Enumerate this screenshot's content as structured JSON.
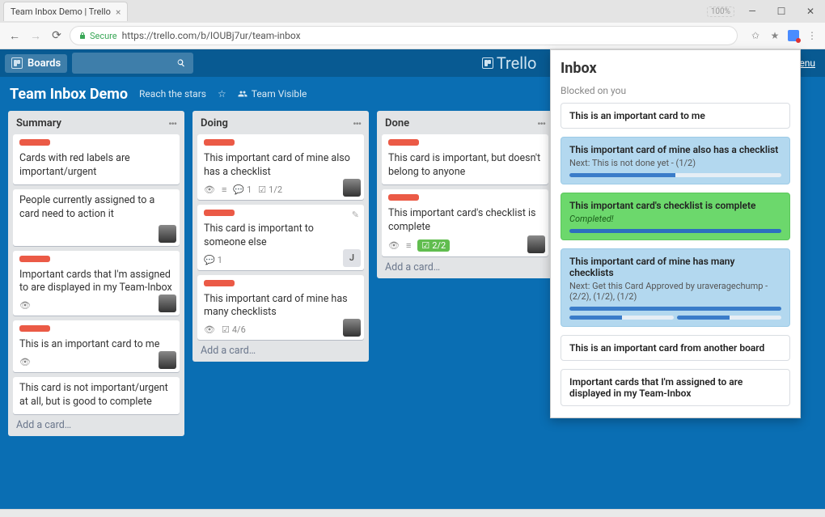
{
  "browser": {
    "tab_title": "Team Inbox Demo | Trello",
    "secure_label": "Secure",
    "url": "https://trello.com/b/IOUBj7ur/team-inbox",
    "win_indicator": "100%"
  },
  "header": {
    "boards_btn": "Boards",
    "logo_text": "Trello",
    "menu_link": "enu"
  },
  "board": {
    "name": "Team Inbox Demo",
    "subtitle": "Reach the stars",
    "visibility": "Team Visible"
  },
  "lists": [
    {
      "title": "Summary",
      "cards": [
        {
          "label": true,
          "text": "Cards with red labels are important/urgent",
          "eye": false
        },
        {
          "label": false,
          "text": "People currently assigned to a card need to action it",
          "avatar": true,
          "eye": false
        },
        {
          "label": true,
          "text": "Important cards that I'm assigned to are displayed in my Team-Inbox",
          "avatar": true,
          "eye": true
        },
        {
          "label": true,
          "text": "This is an important card to me",
          "avatar": true,
          "eye": true
        },
        {
          "label": false,
          "text": "This card is not important/urgent at all, but is good to complete",
          "eye": false
        }
      ],
      "add": "Add a card…"
    },
    {
      "title": "Doing",
      "cards": [
        {
          "label": true,
          "text": "This important card of mine also has a checklist",
          "badges": [
            "eye",
            "align",
            "comment_1",
            "check_1_2"
          ],
          "avatar": true
        },
        {
          "label": true,
          "text": "This card is important to someone else",
          "badges": [
            "comment_1"
          ],
          "avatar_letter": "J",
          "pencil": true
        },
        {
          "label": true,
          "text": "This important card of mine has many checklists",
          "badges": [
            "eye",
            "check_4_6"
          ],
          "avatar": true
        }
      ],
      "add": "Add a card…"
    },
    {
      "title": "Done",
      "cards": [
        {
          "label": true,
          "text": "This card is important, but doesn't belong to anyone"
        },
        {
          "label": true,
          "text": "This important card's checklist is complete",
          "badges": [
            "eye",
            "align",
            "check_2_2_done"
          ],
          "avatar": true
        }
      ],
      "add": "Add a card…"
    }
  ],
  "inbox": {
    "title": "Inbox",
    "section": "Blocked on you",
    "items": [
      {
        "style": "plain",
        "title": "This is an important card to me"
      },
      {
        "style": "blue",
        "title": "This important card of mine also has a checklist",
        "sub": "Next: This is not done yet - (1/2)",
        "progress": 50
      },
      {
        "style": "green",
        "title": "This important card's checklist is complete",
        "sub": "Completed!",
        "progress": 100
      },
      {
        "style": "blue",
        "title": "This important card of mine has many checklists",
        "sub": "Next: Get this Card Approved by uraveragechump - (2/2), (1/2), (1/2)",
        "multi": [
          100,
          50,
          50
        ]
      },
      {
        "style": "plain",
        "title": "This is an important card from another board"
      },
      {
        "style": "plain",
        "title": "Important cards that I'm assigned to are displayed in my Team-Inbox"
      }
    ]
  },
  "badge_text": {
    "comment_1": "1",
    "check_1_2": "1/2",
    "check_4_6": "4/6",
    "check_2_2": "2/2"
  }
}
